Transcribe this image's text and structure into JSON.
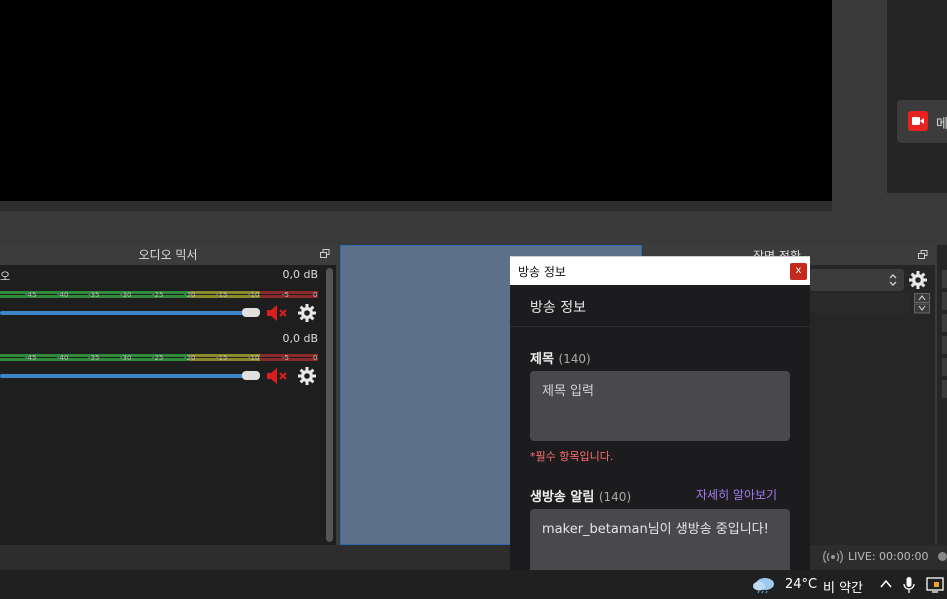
{
  "preview": {
    "meet_button_label": "메"
  },
  "audio_mixer": {
    "title": "오디오 믹서",
    "tick_labels": [
      "-45",
      "-40",
      "-35",
      "-30",
      "-25",
      "-20",
      "-15",
      "-10",
      "-5",
      "0"
    ],
    "channels": [
      {
        "name": "오",
        "db": "0,0 dB",
        "volume": 1.0,
        "muted": true
      },
      {
        "name": "",
        "db": "0,0 dB",
        "volume": 1.0,
        "muted": true
      }
    ]
  },
  "scene_transitions": {
    "title": "장면 전환"
  },
  "status": {
    "live": "LIVE: 00:00:00"
  },
  "taskbar": {
    "temperature": "24°C",
    "weather": "비 약간"
  },
  "dialog": {
    "window_title": "방송 정보",
    "close_label": "x",
    "heading": "방송 정보",
    "title_field": {
      "label": "제목",
      "count": "(140)",
      "placeholder": "제목 입력"
    },
    "required_msg": "*필수 항목입니다.",
    "notice_field": {
      "label": "생방송 알림",
      "count": "(140)",
      "link": "자세히 알아보기",
      "value": "maker_betaman님이 생방송 중입니다!"
    }
  },
  "colors": {
    "meter_green": "#2e8b3a",
    "meter_yellow": "#8a8a2a",
    "meter_red": "#8b2a2a",
    "slider_blue": "#3d85c6",
    "mute_red": "#d81e1e",
    "required_red": "#ff6e6e",
    "link_purple": "#a27cf0",
    "close_red": "#c42b1c"
  }
}
